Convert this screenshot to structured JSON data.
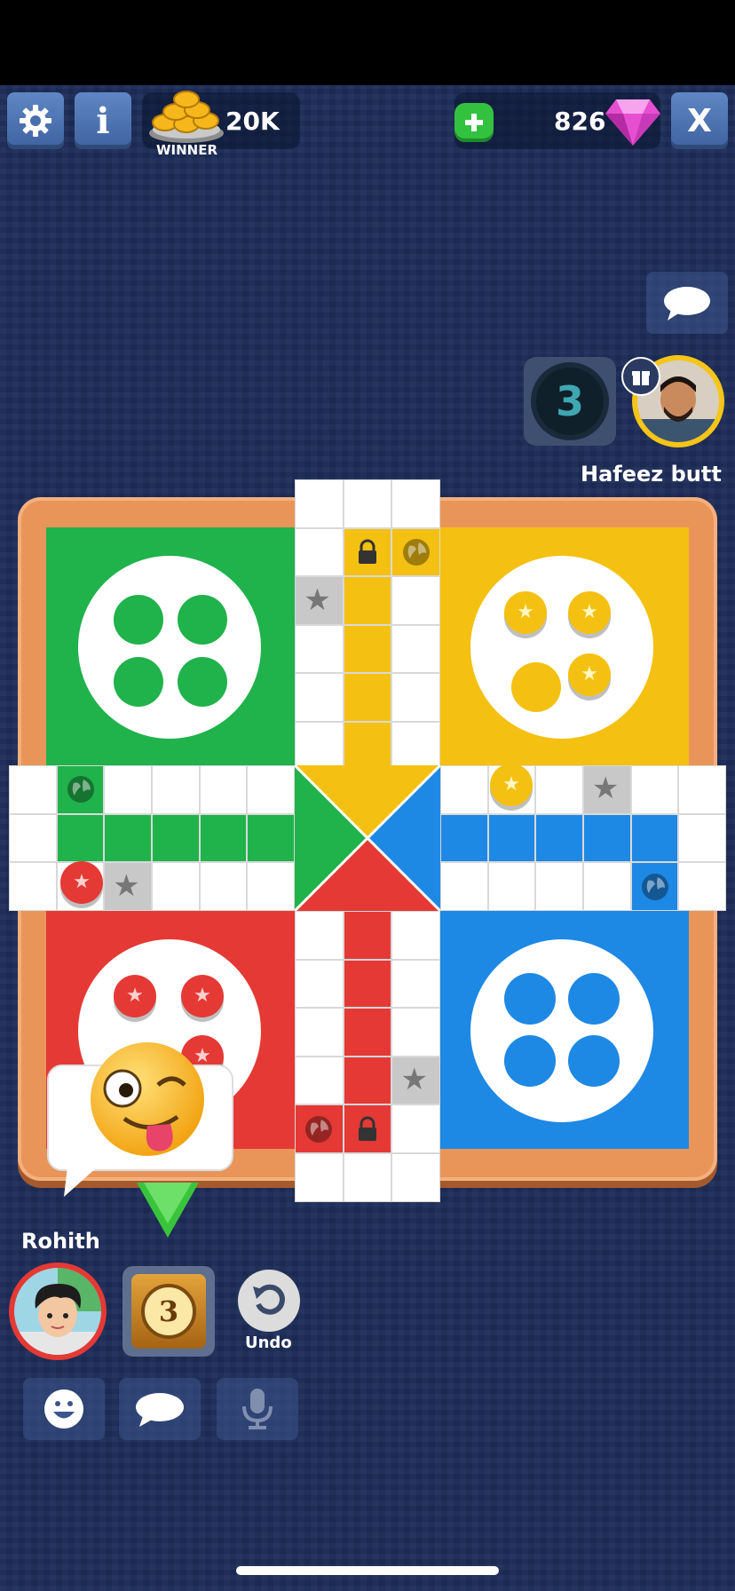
{
  "header": {
    "coins_value": "20K",
    "coins_label": "WINNER",
    "gems_value": "826",
    "settings_icon": "gear-icon",
    "info_label": "i",
    "close_label": "X",
    "add_icon": "plus-icon"
  },
  "opponent": {
    "name": "Hafeez butt",
    "dice_value": "3"
  },
  "player": {
    "name": "Rohith",
    "dice_value": "3",
    "undo_label": "Undo"
  },
  "colors": {
    "green": "#20b24b",
    "yellow": "#f4c012",
    "red": "#e53935",
    "blue": "#1e88e5",
    "board_frame": "#e9955a"
  },
  "controls": {
    "emoji_icon": "smiley-icon",
    "chat_icon": "chat-icon",
    "mic_icon": "microphone-icon"
  }
}
